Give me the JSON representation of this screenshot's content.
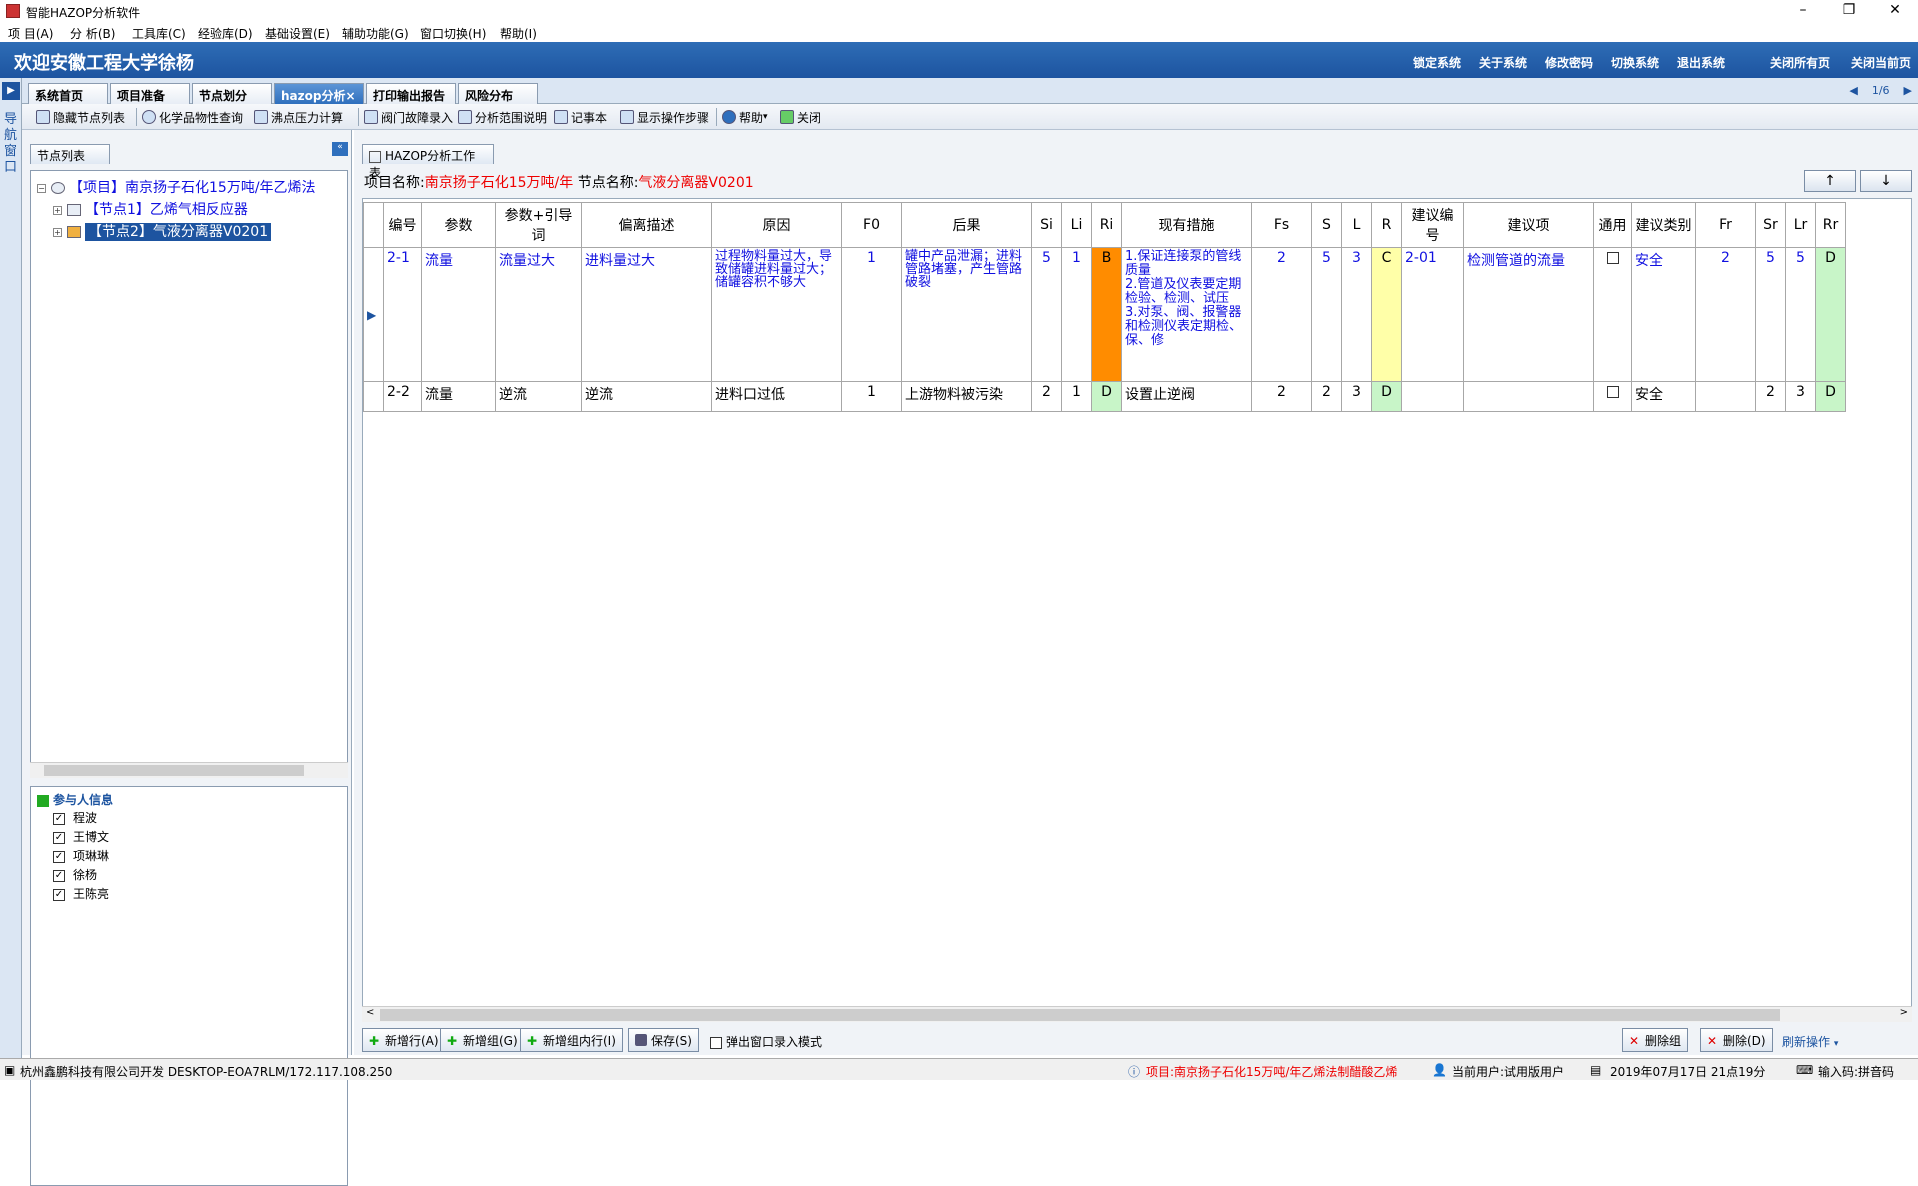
{
  "window": {
    "title": "智能HAZOP分析软件"
  },
  "menu": [
    "项 目(A)",
    "分 析(B)",
    "工具库(C)",
    "经验库(D)",
    "基础设置(E)",
    "辅助功能(G)",
    "窗口切换(H)",
    "帮助(I)"
  ],
  "banner": {
    "welcome": "欢迎安徽工程大学徐杨",
    "links": [
      "锁定系统",
      "关于系统",
      "修改密码",
      "切换系统",
      "退出系统",
      "关闭所有页",
      "关闭当前页"
    ]
  },
  "nav_strip": {
    "label_chars": [
      "导",
      "航",
      "窗",
      "口"
    ]
  },
  "tabs": [
    "系统首页",
    "项目准备",
    "节点划分",
    "hazop分析",
    "打印输出报告",
    "风险分布"
  ],
  "tab_close": "×",
  "pager": "1/6",
  "toolbar": [
    "隐藏节点列表",
    "化学品物性查询",
    "沸点压力计算",
    "阀门故障录入",
    "分析范围说明",
    "记事本",
    "显示操作步骤",
    "帮助",
    "关闭"
  ],
  "left_panel": {
    "tab": "节点列表",
    "tree": {
      "project": "【项目】南京扬子石化15万吨/年乙烯法",
      "nodes": [
        "【节点1】乙烯气相反应器",
        "【节点2】气液分离器V0201"
      ]
    },
    "participants_title": "参与人信息",
    "participants": [
      "程波",
      "王博文",
      "项琳琳",
      "徐杨",
      "王陈亮"
    ]
  },
  "work": {
    "tab": "HAZOP分析工作表",
    "project_label": "项目名称:",
    "project_name": "南京扬子石化15万吨/年",
    "node_label": "节点名称:",
    "node_name": "气液分离器V0201",
    "up_btn": "↑",
    "down_btn": "↓",
    "columns": [
      "编号",
      "参数",
      "参数+引导词",
      "偏离描述",
      "原因",
      "F0",
      "后果",
      "Si",
      "Li",
      "Ri",
      "现有措施",
      "Fs",
      "S",
      "L",
      "R",
      "建议编号",
      "建议项",
      "通用",
      "建议类别",
      "Fr",
      "Sr",
      "Lr",
      "Rr"
    ],
    "rows": [
      {
        "id": "2-1",
        "param": "流量",
        "guide": "流量过大",
        "deviation": "进料量过大",
        "cause": "过程物料量过大，导致储罐进料量过大；储罐容积不够大",
        "f0": "1",
        "consequence": "罐中产品泄漏；进料管路堵塞，产生管路破裂",
        "si": "5",
        "li": "1",
        "ri": "B",
        "measures": "1.保证连接泵的管线质量\n2.管道及仪表要定期检验、检测、试压\n3.对泵、阀、报警器和检测仪表定期检、保、修",
        "fs": "2",
        "s": "5",
        "l": "3",
        "r": "C",
        "sug_id": "2-01",
        "suggestion": "检测管道的流量",
        "common": "",
        "category": "安全",
        "fr": "2",
        "sr": "5",
        "lr": "5",
        "rr": "D"
      },
      {
        "id": "2-2",
        "param": "流量",
        "guide": "逆流",
        "deviation": "逆流",
        "cause": "进料口过低",
        "f0": "1",
        "consequence": "上游物料被污染",
        "si": "2",
        "li": "1",
        "ri": "D",
        "measures": "设置止逆阀",
        "fs": "2",
        "s": "2",
        "l": "3",
        "r": "D",
        "sug_id": "",
        "suggestion": "",
        "common": "",
        "category": "安全",
        "fr": "",
        "sr": "2",
        "lr": "3",
        "rr": "D"
      }
    ],
    "cell_colors": {
      "ri_b": "#ff8c00",
      "r_c": "#ffffa8",
      "green": "#c8f5c8"
    }
  },
  "bottom_buttons": [
    "新增行(A)",
    "新增组(G)",
    "新增组内行(I)",
    "保存(S)"
  ],
  "popup_mode": "弹出窗口录入模式",
  "right_buttons": [
    "删除组",
    "删除(D)",
    "刷新操作"
  ],
  "status": {
    "company": "杭州鑫鹏科技有限公司开发  DESKTOP-EOA7RLM/172.117.108.250",
    "project": "项目:南京扬子石化15万吨/年乙烯法制醋酸乙烯",
    "user": "当前用户:试用版用户",
    "date": "2019年07月17日  21点19分",
    "ime": "输入码:拼音码"
  }
}
